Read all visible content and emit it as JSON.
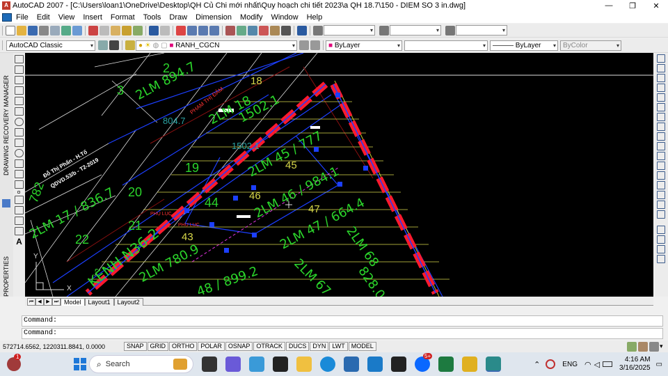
{
  "window": {
    "app_icon": "A",
    "title": "AutoCAD 2007 - [C:\\Users\\loan1\\OneDrive\\Desktop\\QH Củ Chi mới nhất\\Quy hoạch chi tiết 2023\\a QH 18.7\\150 - DIEM SO 3 in.dwg]",
    "minimize": "—",
    "restore": "❐",
    "close": "✕"
  },
  "menu": {
    "items": [
      "File",
      "Edit",
      "View",
      "Insert",
      "Format",
      "Tools",
      "Draw",
      "Dimension",
      "Modify",
      "Window",
      "Help"
    ]
  },
  "toolbar_props": {
    "workspace": "AutoCAD Classic",
    "layer": "RANH_CGCN",
    "color": "ByLayer",
    "linetype": "ByLayer",
    "lineweight": "ByColor"
  },
  "left_strip": {
    "recovery": "DRAWING RECOVERY MANAGER",
    "properties": "PROPERTIES"
  },
  "drawing": {
    "labels_green": [
      {
        "t": "2LM  894.7"
      },
      {
        "t": "2LM  18"
      },
      {
        "t": "1502.1"
      },
      {
        "t": "19"
      },
      {
        "t": "20"
      },
      {
        "t": "2LM  17 / 836.7"
      },
      {
        "t": "2LM  45 / 777"
      },
      {
        "t": "2LM 46 / 984.1"
      },
      {
        "t": "44"
      },
      {
        "t": "2LM 47 / 664.4"
      },
      {
        "t": "2LM  780.9"
      },
      {
        "t": "2LM  68"
      },
      {
        "t": "828.0"
      },
      {
        "t": "2LM  67"
      },
      {
        "t": "48 / 899.2"
      },
      {
        "t": "KÊNH N36-2"
      },
      {
        "t": "21"
      },
      {
        "t": "22"
      },
      {
        "t": "782"
      },
      {
        "t": "3"
      },
      {
        "t": "2"
      }
    ],
    "labels_yellow": [
      {
        "t": "18"
      },
      {
        "t": "46"
      },
      {
        "t": "43"
      },
      {
        "t": "47"
      },
      {
        "t": "45"
      }
    ],
    "labels_teal": [
      {
        "t": "804.7"
      },
      {
        "t": "1502.1"
      }
    ],
    "labels_white": [
      {
        "t": "Đỗ Thị Phấn - H.Tổ"
      },
      {
        "t": "QDVD.53/b - T2-2019"
      }
    ],
    "labels_red": [
      {
        "t": "PHẠM THỊ ĐẢM"
      },
      {
        "t": "PHỤ LỤC"
      },
      {
        "t": "PHỤ LỤC"
      }
    ],
    "axis": {
      "y": "Y",
      "x": "X"
    }
  },
  "tabs": {
    "nav": [
      "⏮",
      "◀",
      "▶",
      "⏭"
    ],
    "items": [
      "Model",
      "Layout1",
      "Layout2"
    ],
    "active": "Model"
  },
  "command": {
    "line1": "Command:",
    "line2": "Command:"
  },
  "status": {
    "coords": "572714.6562, 1220311.8841, 0.0000",
    "buttons": [
      "SNAP",
      "GRID",
      "ORTHO",
      "POLAR",
      "OSNAP",
      "OTRACK",
      "DUCS",
      "DYN",
      "LWT",
      "MODEL"
    ]
  },
  "taskbar": {
    "search_placeholder": "Search",
    "badge_left": "1",
    "zalo_badge": "5+",
    "lang": "ENG",
    "time": "4:16 AM",
    "date": "3/16/2025"
  },
  "colors": {
    "canvas": "#000000",
    "green": "#2bd52b",
    "red": "#ff1a2e",
    "blue": "#1c3fff",
    "yellow": "#d8d84a",
    "teal": "#2aa1a1"
  }
}
